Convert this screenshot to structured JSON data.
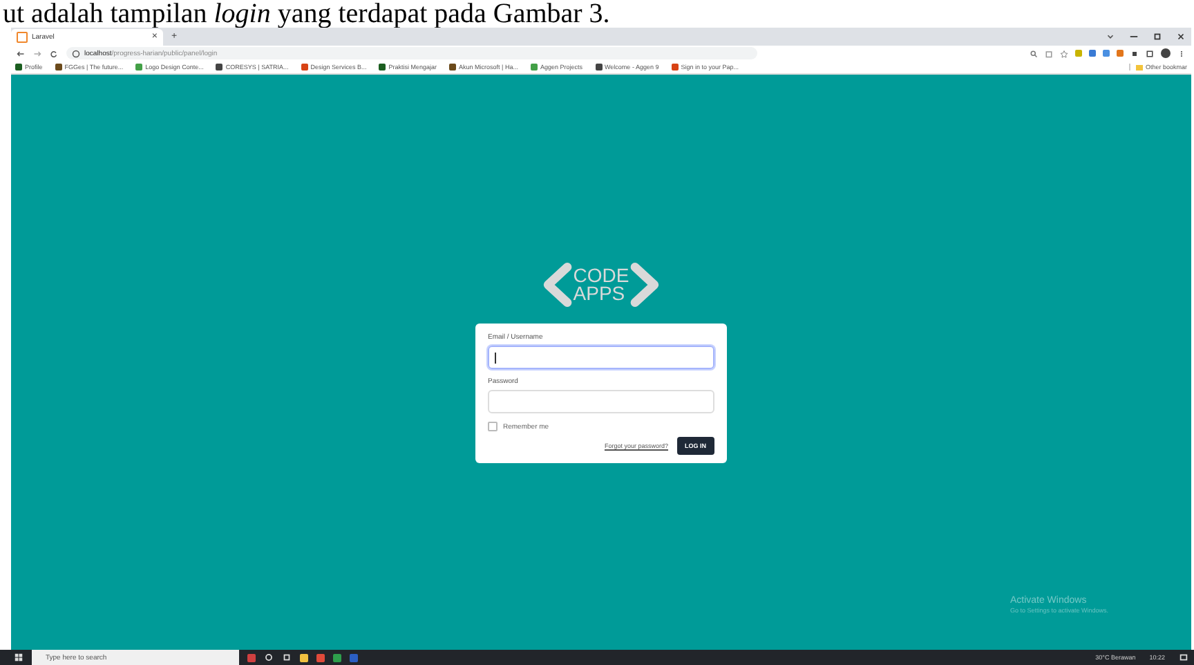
{
  "caption": "ut adalah tampilan *login* yang terdapat pada Gambar 3.",
  "tab": {
    "title": "Laravel",
    "close": "×",
    "new_tab": "+"
  },
  "address_bar": {
    "url_host": "localhost",
    "url_path": "/progress-harian/public/panel/login"
  },
  "bookmarks": [
    {
      "label": "Profile"
    },
    {
      "label": "FGGes | The future..."
    },
    {
      "label": "Logo Design Conte..."
    },
    {
      "label": "CORESYS | SATRIA..."
    },
    {
      "label": "Design Services B..."
    },
    {
      "label": "Praktisi Mengajar"
    },
    {
      "label": "Akun Microsoft | Ha..."
    },
    {
      "label": "Aggen Projects"
    },
    {
      "label": "Welcome - Aggen 9"
    },
    {
      "label": "Sign in to your Pap..."
    }
  ],
  "other_bookmarks": "Other bookmar",
  "logo": {
    "top": "CODE",
    "bottom": "APPS"
  },
  "login": {
    "email_label": "Email / Username",
    "email_focused": true,
    "password_label": "Password",
    "remember_label": "Remember me",
    "remember_checked": false,
    "forgot_link": "Forgot your password?",
    "submit": "LOG IN"
  },
  "watermark": {
    "title": "Activate Windows",
    "subtitle": "Go to Settings to activate Windows."
  },
  "taskbar": {
    "search_placeholder": "Type here to search",
    "weather": "30°C Berawan",
    "time": "10:22"
  }
}
